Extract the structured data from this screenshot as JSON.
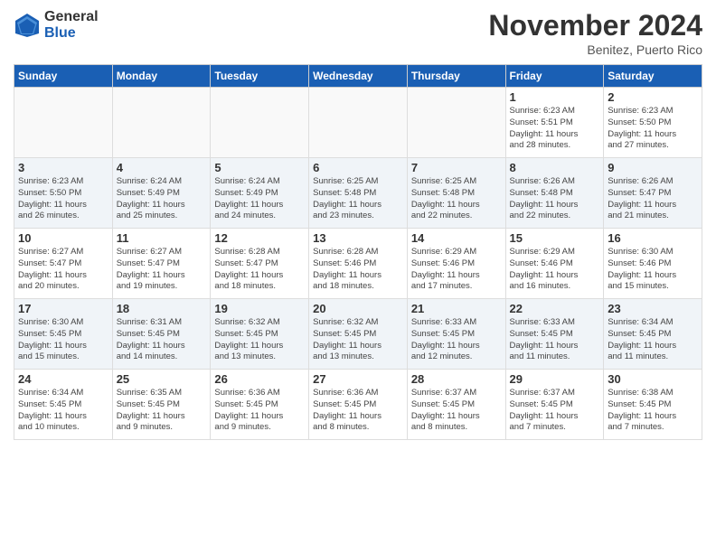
{
  "logo": {
    "general": "General",
    "blue": "Blue"
  },
  "header": {
    "month": "November 2024",
    "location": "Benitez, Puerto Rico"
  },
  "weekdays": [
    "Sunday",
    "Monday",
    "Tuesday",
    "Wednesday",
    "Thursday",
    "Friday",
    "Saturday"
  ],
  "weeks": [
    [
      {
        "day": "",
        "info": ""
      },
      {
        "day": "",
        "info": ""
      },
      {
        "day": "",
        "info": ""
      },
      {
        "day": "",
        "info": ""
      },
      {
        "day": "",
        "info": ""
      },
      {
        "day": "1",
        "info": "Sunrise: 6:23 AM\nSunset: 5:51 PM\nDaylight: 11 hours\nand 28 minutes."
      },
      {
        "day": "2",
        "info": "Sunrise: 6:23 AM\nSunset: 5:50 PM\nDaylight: 11 hours\nand 27 minutes."
      }
    ],
    [
      {
        "day": "3",
        "info": "Sunrise: 6:23 AM\nSunset: 5:50 PM\nDaylight: 11 hours\nand 26 minutes."
      },
      {
        "day": "4",
        "info": "Sunrise: 6:24 AM\nSunset: 5:49 PM\nDaylight: 11 hours\nand 25 minutes."
      },
      {
        "day": "5",
        "info": "Sunrise: 6:24 AM\nSunset: 5:49 PM\nDaylight: 11 hours\nand 24 minutes."
      },
      {
        "day": "6",
        "info": "Sunrise: 6:25 AM\nSunset: 5:48 PM\nDaylight: 11 hours\nand 23 minutes."
      },
      {
        "day": "7",
        "info": "Sunrise: 6:25 AM\nSunset: 5:48 PM\nDaylight: 11 hours\nand 22 minutes."
      },
      {
        "day": "8",
        "info": "Sunrise: 6:26 AM\nSunset: 5:48 PM\nDaylight: 11 hours\nand 22 minutes."
      },
      {
        "day": "9",
        "info": "Sunrise: 6:26 AM\nSunset: 5:47 PM\nDaylight: 11 hours\nand 21 minutes."
      }
    ],
    [
      {
        "day": "10",
        "info": "Sunrise: 6:27 AM\nSunset: 5:47 PM\nDaylight: 11 hours\nand 20 minutes."
      },
      {
        "day": "11",
        "info": "Sunrise: 6:27 AM\nSunset: 5:47 PM\nDaylight: 11 hours\nand 19 minutes."
      },
      {
        "day": "12",
        "info": "Sunrise: 6:28 AM\nSunset: 5:47 PM\nDaylight: 11 hours\nand 18 minutes."
      },
      {
        "day": "13",
        "info": "Sunrise: 6:28 AM\nSunset: 5:46 PM\nDaylight: 11 hours\nand 18 minutes."
      },
      {
        "day": "14",
        "info": "Sunrise: 6:29 AM\nSunset: 5:46 PM\nDaylight: 11 hours\nand 17 minutes."
      },
      {
        "day": "15",
        "info": "Sunrise: 6:29 AM\nSunset: 5:46 PM\nDaylight: 11 hours\nand 16 minutes."
      },
      {
        "day": "16",
        "info": "Sunrise: 6:30 AM\nSunset: 5:46 PM\nDaylight: 11 hours\nand 15 minutes."
      }
    ],
    [
      {
        "day": "17",
        "info": "Sunrise: 6:30 AM\nSunset: 5:45 PM\nDaylight: 11 hours\nand 15 minutes."
      },
      {
        "day": "18",
        "info": "Sunrise: 6:31 AM\nSunset: 5:45 PM\nDaylight: 11 hours\nand 14 minutes."
      },
      {
        "day": "19",
        "info": "Sunrise: 6:32 AM\nSunset: 5:45 PM\nDaylight: 11 hours\nand 13 minutes."
      },
      {
        "day": "20",
        "info": "Sunrise: 6:32 AM\nSunset: 5:45 PM\nDaylight: 11 hours\nand 13 minutes."
      },
      {
        "day": "21",
        "info": "Sunrise: 6:33 AM\nSunset: 5:45 PM\nDaylight: 11 hours\nand 12 minutes."
      },
      {
        "day": "22",
        "info": "Sunrise: 6:33 AM\nSunset: 5:45 PM\nDaylight: 11 hours\nand 11 minutes."
      },
      {
        "day": "23",
        "info": "Sunrise: 6:34 AM\nSunset: 5:45 PM\nDaylight: 11 hours\nand 11 minutes."
      }
    ],
    [
      {
        "day": "24",
        "info": "Sunrise: 6:34 AM\nSunset: 5:45 PM\nDaylight: 11 hours\nand 10 minutes."
      },
      {
        "day": "25",
        "info": "Sunrise: 6:35 AM\nSunset: 5:45 PM\nDaylight: 11 hours\nand 9 minutes."
      },
      {
        "day": "26",
        "info": "Sunrise: 6:36 AM\nSunset: 5:45 PM\nDaylight: 11 hours\nand 9 minutes."
      },
      {
        "day": "27",
        "info": "Sunrise: 6:36 AM\nSunset: 5:45 PM\nDaylight: 11 hours\nand 8 minutes."
      },
      {
        "day": "28",
        "info": "Sunrise: 6:37 AM\nSunset: 5:45 PM\nDaylight: 11 hours\nand 8 minutes."
      },
      {
        "day": "29",
        "info": "Sunrise: 6:37 AM\nSunset: 5:45 PM\nDaylight: 11 hours\nand 7 minutes."
      },
      {
        "day": "30",
        "info": "Sunrise: 6:38 AM\nSunset: 5:45 PM\nDaylight: 11 hours\nand 7 minutes."
      }
    ]
  ]
}
